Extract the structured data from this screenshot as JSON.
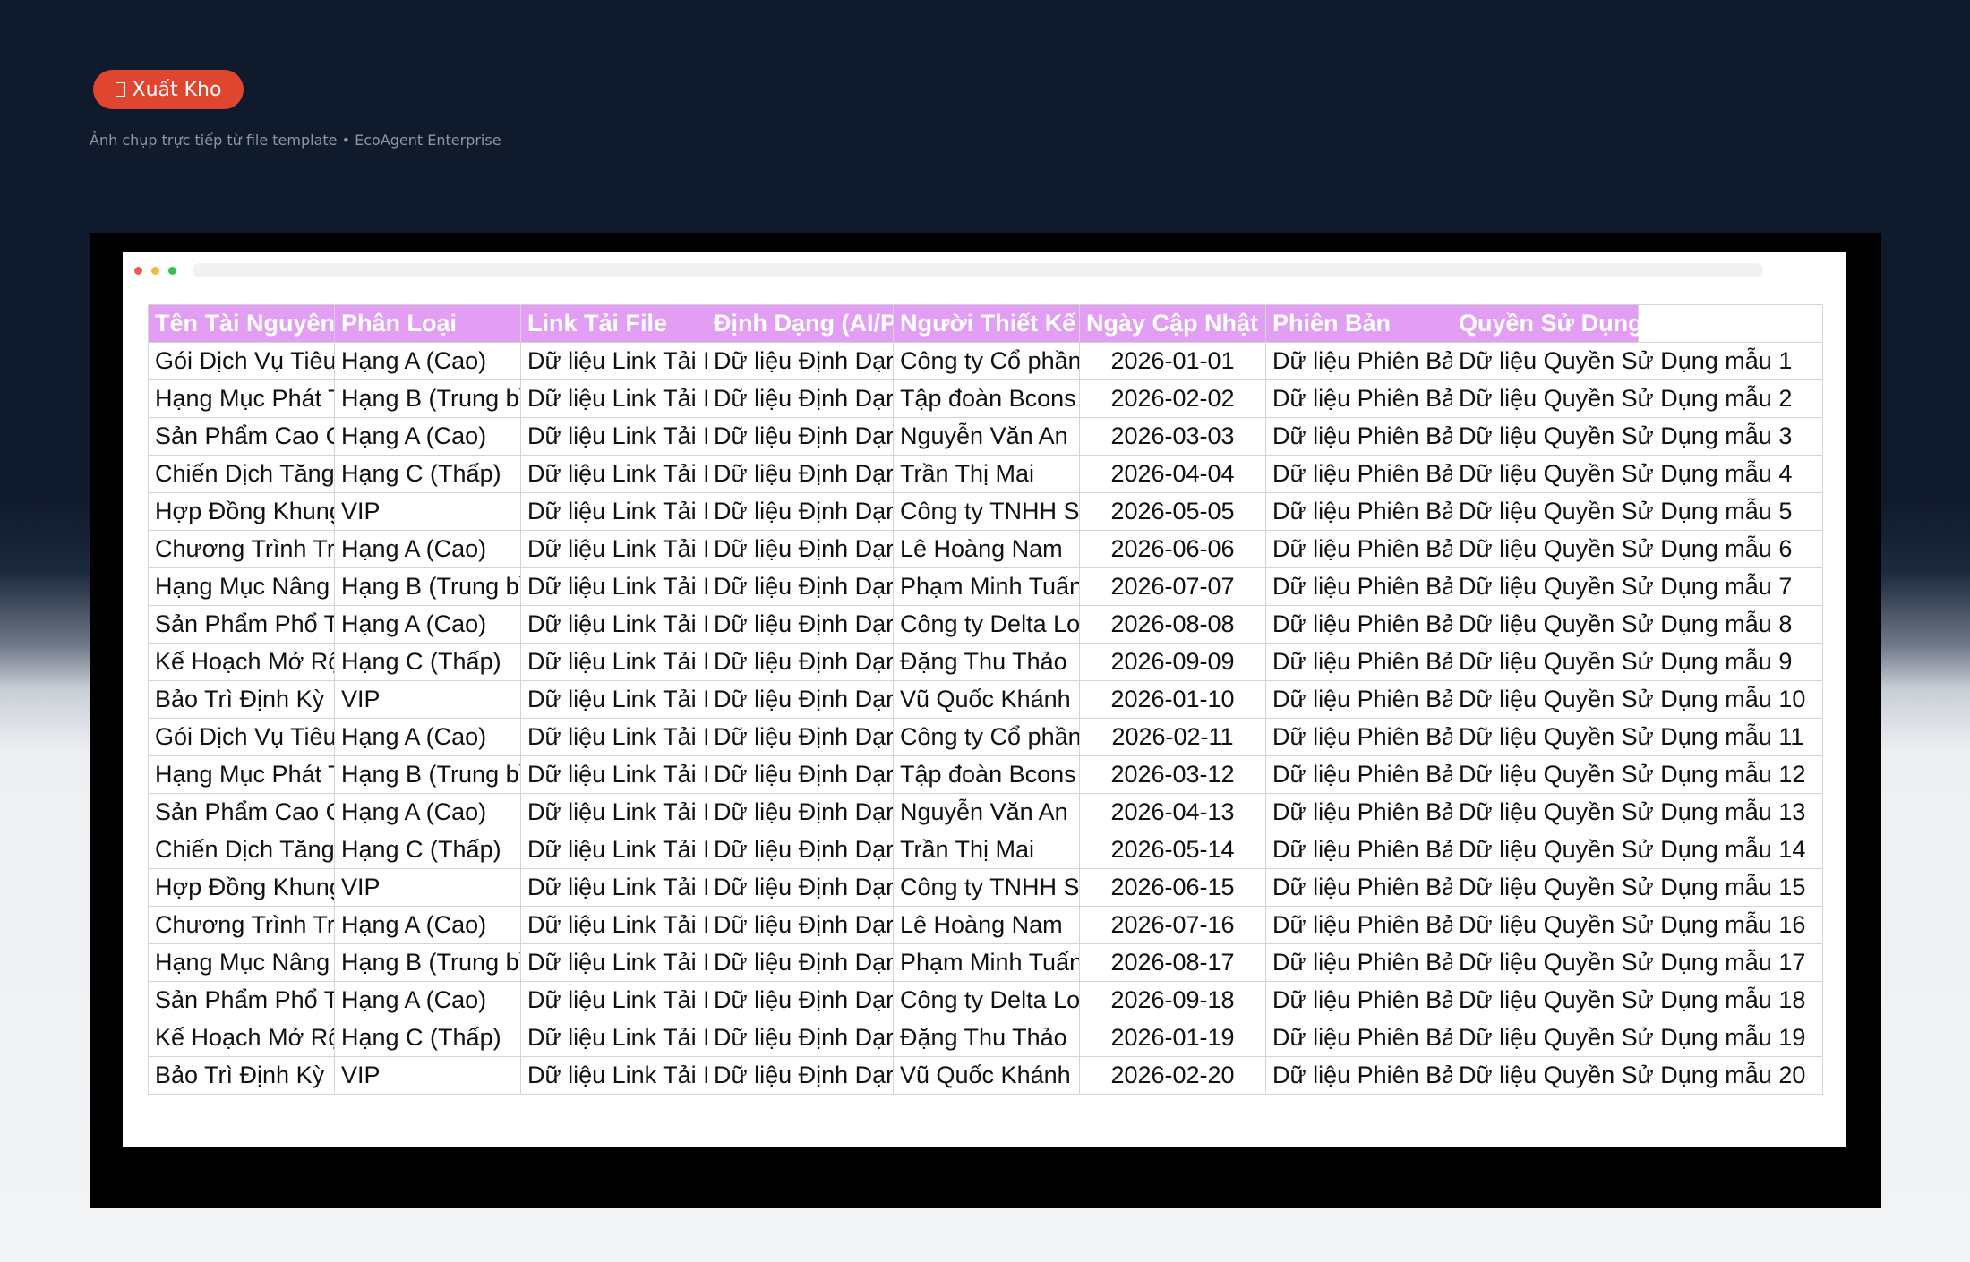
{
  "toolbar": {
    "export_icon": "document-icon",
    "export_label": "Xuất Kho"
  },
  "caption": "Ảnh chụp trực tiếp từ file template • EcoAgent Enterprise",
  "colors": {
    "page_background": "#0f1a2c",
    "export_button": "#e0462f",
    "header_fill": "#e29ef2"
  },
  "table": {
    "headers": [
      "Tên Tài Nguyên",
      "Phân Loại",
      "Link Tải File",
      "Định Dạng (AI/P",
      "Người Thiết Kế",
      "Ngày Cập Nhật",
      "Phiên Bản",
      "Quyền Sử Dụng"
    ],
    "rows": [
      [
        "Gói Dịch Vụ Tiêu",
        "Hạng A (Cao)",
        "Dữ liệu Link Tải I",
        "Dữ liệu Định Dạr",
        "Công ty Cổ phần",
        "2026-01-01",
        "Dữ liệu Phiên Bả",
        "Dữ liệu Quyền Sử Dụng mẫu 1"
      ],
      [
        "Hạng Mục Phát T",
        "Hạng B (Trung bì",
        "Dữ liệu Link Tải I",
        "Dữ liệu Định Dạr",
        "Tập đoàn Bcons",
        "2026-02-02",
        "Dữ liệu Phiên Bả",
        "Dữ liệu Quyền Sử Dụng mẫu 2"
      ],
      [
        "Sản Phẩm Cao C",
        "Hạng A (Cao)",
        "Dữ liệu Link Tải I",
        "Dữ liệu Định Dạr",
        "Nguyễn Văn An",
        "2026-03-03",
        "Dữ liệu Phiên Bả",
        "Dữ liệu Quyền Sử Dụng mẫu 3"
      ],
      [
        "Chiến Dịch Tăng",
        "Hạng C (Thấp)",
        "Dữ liệu Link Tải I",
        "Dữ liệu Định Dạr",
        "Trần Thị Mai",
        "2026-04-04",
        "Dữ liệu Phiên Bả",
        "Dữ liệu Quyền Sử Dụng mẫu 4"
      ],
      [
        "Hợp Đồng Khung",
        "VIP",
        "Dữ liệu Link Tải I",
        "Dữ liệu Định Dạr",
        "Công ty TNHH S",
        "2026-05-05",
        "Dữ liệu Phiên Bả",
        "Dữ liệu Quyền Sử Dụng mẫu 5"
      ],
      [
        "Chương Trình Tr",
        "Hạng A (Cao)",
        "Dữ liệu Link Tải I",
        "Dữ liệu Định Dạr",
        "Lê Hoàng Nam",
        "2026-06-06",
        "Dữ liệu Phiên Bả",
        "Dữ liệu Quyền Sử Dụng mẫu 6"
      ],
      [
        "Hạng Mục Nâng",
        "Hạng B (Trung bì",
        "Dữ liệu Link Tải I",
        "Dữ liệu Định Dạr",
        "Phạm Minh Tuấn",
        "2026-07-07",
        "Dữ liệu Phiên Bả",
        "Dữ liệu Quyền Sử Dụng mẫu 7"
      ],
      [
        "Sản Phẩm Phổ T",
        "Hạng A (Cao)",
        "Dữ liệu Link Tải I",
        "Dữ liệu Định Dạr",
        "Công ty Delta Lo",
        "2026-08-08",
        "Dữ liệu Phiên Bả",
        "Dữ liệu Quyền Sử Dụng mẫu 8"
      ],
      [
        "Kế Hoạch Mở Rộ",
        "Hạng C (Thấp)",
        "Dữ liệu Link Tải I",
        "Dữ liệu Định Dạr",
        "Đặng Thu Thảo",
        "2026-09-09",
        "Dữ liệu Phiên Bả",
        "Dữ liệu Quyền Sử Dụng mẫu 9"
      ],
      [
        "Bảo Trì Định Kỳ",
        "VIP",
        "Dữ liệu Link Tải I",
        "Dữ liệu Định Dạr",
        "Vũ Quốc Khánh",
        "2026-01-10",
        "Dữ liệu Phiên Bả",
        "Dữ liệu Quyền Sử Dụng mẫu 10"
      ],
      [
        "Gói Dịch Vụ Tiêu",
        "Hạng A (Cao)",
        "Dữ liệu Link Tải I",
        "Dữ liệu Định Dạr",
        "Công ty Cổ phần",
        "2026-02-11",
        "Dữ liệu Phiên Bả",
        "Dữ liệu Quyền Sử Dụng mẫu 11"
      ],
      [
        "Hạng Mục Phát T",
        "Hạng B (Trung bì",
        "Dữ liệu Link Tải I",
        "Dữ liệu Định Dạr",
        "Tập đoàn Bcons",
        "2026-03-12",
        "Dữ liệu Phiên Bả",
        "Dữ liệu Quyền Sử Dụng mẫu 12"
      ],
      [
        "Sản Phẩm Cao C",
        "Hạng A (Cao)",
        "Dữ liệu Link Tải I",
        "Dữ liệu Định Dạr",
        "Nguyễn Văn An",
        "2026-04-13",
        "Dữ liệu Phiên Bả",
        "Dữ liệu Quyền Sử Dụng mẫu 13"
      ],
      [
        "Chiến Dịch Tăng",
        "Hạng C (Thấp)",
        "Dữ liệu Link Tải I",
        "Dữ liệu Định Dạr",
        "Trần Thị Mai",
        "2026-05-14",
        "Dữ liệu Phiên Bả",
        "Dữ liệu Quyền Sử Dụng mẫu 14"
      ],
      [
        "Hợp Đồng Khung",
        "VIP",
        "Dữ liệu Link Tải I",
        "Dữ liệu Định Dạr",
        "Công ty TNHH S",
        "2026-06-15",
        "Dữ liệu Phiên Bả",
        "Dữ liệu Quyền Sử Dụng mẫu 15"
      ],
      [
        "Chương Trình Tr",
        "Hạng A (Cao)",
        "Dữ liệu Link Tải I",
        "Dữ liệu Định Dạr",
        "Lê Hoàng Nam",
        "2026-07-16",
        "Dữ liệu Phiên Bả",
        "Dữ liệu Quyền Sử Dụng mẫu 16"
      ],
      [
        "Hạng Mục Nâng",
        "Hạng B (Trung bì",
        "Dữ liệu Link Tải I",
        "Dữ liệu Định Dạr",
        "Phạm Minh Tuấn",
        "2026-08-17",
        "Dữ liệu Phiên Bả",
        "Dữ liệu Quyền Sử Dụng mẫu 17"
      ],
      [
        "Sản Phẩm Phổ T",
        "Hạng A (Cao)",
        "Dữ liệu Link Tải I",
        "Dữ liệu Định Dạr",
        "Công ty Delta Lo",
        "2026-09-18",
        "Dữ liệu Phiên Bả",
        "Dữ liệu Quyền Sử Dụng mẫu 18"
      ],
      [
        "Kế Hoạch Mở Rộ",
        "Hạng C (Thấp)",
        "Dữ liệu Link Tải I",
        "Dữ liệu Định Dạr",
        "Đặng Thu Thảo",
        "2026-01-19",
        "Dữ liệu Phiên Bả",
        "Dữ liệu Quyền Sử Dụng mẫu 19"
      ],
      [
        "Bảo Trì Định Kỳ",
        "VIP",
        "Dữ liệu Link Tải I",
        "Dữ liệu Định Dạr",
        "Vũ Quốc Khánh",
        "2026-02-20",
        "Dữ liệu Phiên Bả",
        "Dữ liệu Quyền Sử Dụng mẫu 20"
      ]
    ]
  }
}
